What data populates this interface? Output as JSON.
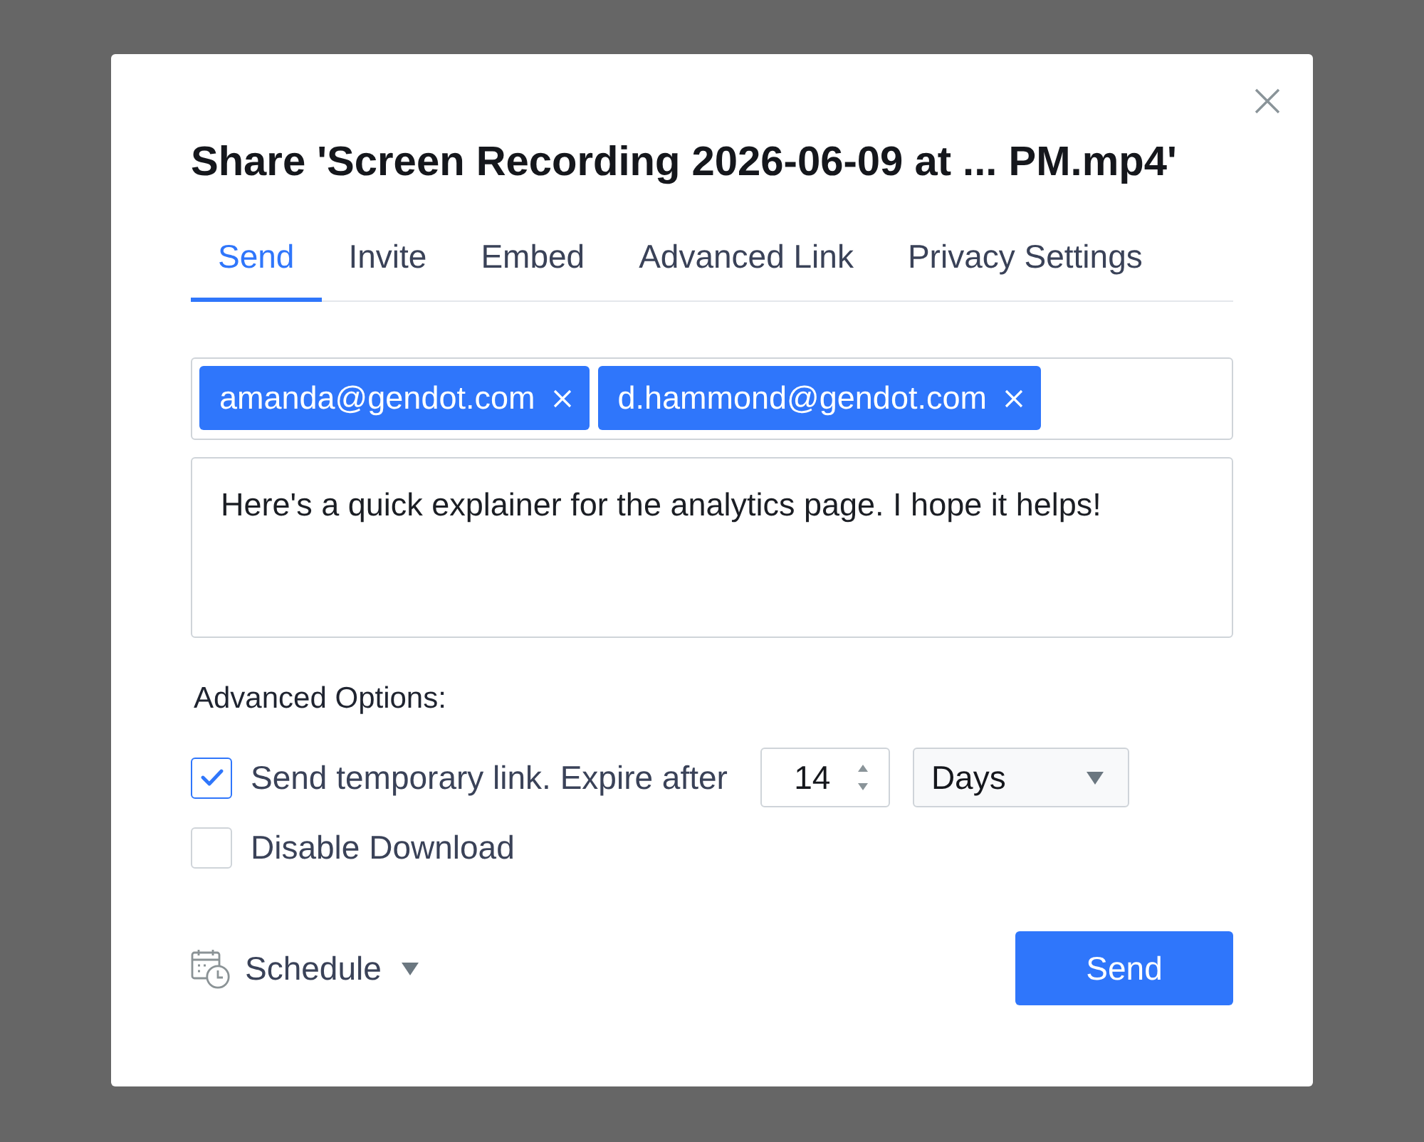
{
  "dialog": {
    "title": "Share 'Screen Recording 2026-06-09 at ... PM.mp4'",
    "tabs": [
      {
        "label": "Send",
        "selected": true
      },
      {
        "label": "Invite",
        "selected": false
      },
      {
        "label": "Embed",
        "selected": false
      },
      {
        "label": "Advanced Link",
        "selected": false
      },
      {
        "label": "Privacy Settings",
        "selected": false
      }
    ],
    "recipients": [
      {
        "email": "amanda@gendot.com"
      },
      {
        "email": "d.hammond@gendot.com"
      }
    ],
    "message": {
      "value": "Here's a quick explainer for the analytics page. I hope it helps!"
    },
    "advanced_options": {
      "heading": "Advanced Options:",
      "options": [
        {
          "kind": "expiry",
          "label": "Send temporary link. Expire after",
          "checked": true,
          "amount": "14",
          "unit": "Days"
        },
        {
          "kind": "toggle",
          "label": "Disable Download",
          "checked": false
        }
      ]
    },
    "schedule": {
      "label": "Schedule"
    },
    "send_button": {
      "label": "Send"
    }
  }
}
